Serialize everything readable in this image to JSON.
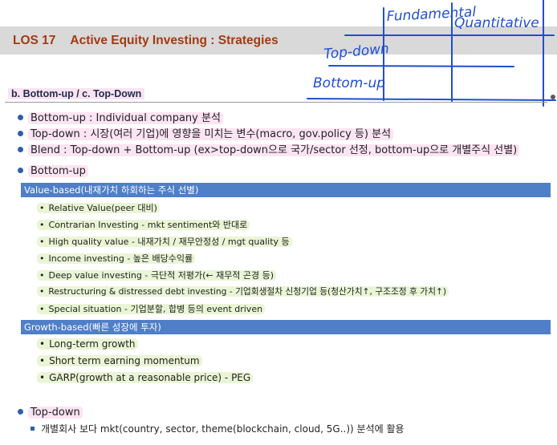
{
  "header": {
    "los_number": "LOS 17",
    "title": "Active Equity Investing : Strategies"
  },
  "handwriting": {
    "fundamental": "Fundamental",
    "quantitative": "Quantitative",
    "top_down": "Top-down",
    "bottom_up": "Bottom-up"
  },
  "section": {
    "label": "b. Bottom-up  /  c. Top-Down"
  },
  "overview": [
    "Bottom-up : Individual company 분석",
    "Top-down : 시장(여러 기업)에 영향을 미치는 변수(macro, gov.policy 등) 분석",
    "Blend : Top-down + Bottom-up (ex>top-down으로 국가/sector 선정, bottom-up으로 개별주식 선별)"
  ],
  "bottom_up": {
    "label": "Bottom-up",
    "value_based": {
      "header": "Value-based(내재가치 하회하는 주식 선별)",
      "items": [
        "Relative Value(peer 대비)",
        "Contrarian Investing - mkt sentiment와 반대로",
        "High quality value - 내재가치 / 재무안정성 / mgt quality 등",
        "Income investing - 높은 배당수익률",
        "Deep value investing - 극단적 저평가(← 재무적 곤경 등)",
        "Restructuring & distressed debt investing - 기업회생절차 신청기업 등(청산가치↑, 구조조정 후 가치↑)",
        "Special situation - 기업분할, 합병 등의 event driven"
      ]
    },
    "growth_based": {
      "header": "Growth-based(빠른 성장에 투자)",
      "items": [
        "Long-term growth",
        "Short term earning momentum",
        "GARP(growth at a reasonable price) - PEG"
      ]
    }
  },
  "top_down": {
    "label": "Top-down",
    "items": [
      "개별회사 보다 mkt(country, sector, theme(blockchain, cloud, 5G..)) 분석에 활용"
    ]
  },
  "colors": {
    "accent_title": "#a23a12",
    "bar_blue": "#4f7fc7",
    "bullet_blue": "#2e5fa8",
    "pink_highlight": "#fce4f3",
    "green_highlight": "#eaf5d6",
    "ink_blue": "#1f4fd1"
  }
}
